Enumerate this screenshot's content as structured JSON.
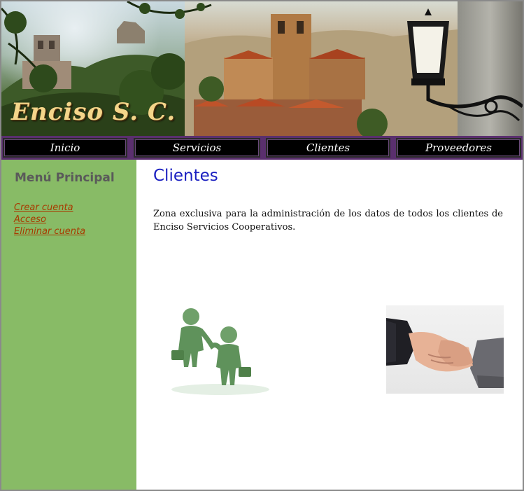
{
  "banner": {
    "logo_text": "Enciso S. C."
  },
  "nav": {
    "tabs": [
      {
        "label": "Inicio"
      },
      {
        "label": "Servicios"
      },
      {
        "label": "Clientes"
      },
      {
        "label": "Proveedores"
      }
    ]
  },
  "sidebar": {
    "title": "Menú Principal",
    "items": [
      {
        "label": "Crear cuenta"
      },
      {
        "label": "Acceso"
      },
      {
        "label": "Eliminar cuenta"
      }
    ]
  },
  "main": {
    "title": "Clientes",
    "intro": "Zona exclusiva para la administración de los datos de todos los clientes de Enciso Servicios Cooperativos."
  },
  "colors": {
    "nav_bar": "#5a2f6e",
    "sidebar_bg": "#88bb66",
    "title_blue": "#1a1fc0",
    "link": "#a83a00",
    "logo_gold": "#f4d58a"
  },
  "icons": {
    "people_image": "two-figures-handshake-image",
    "handshake_image": "business-handshake-photo"
  }
}
